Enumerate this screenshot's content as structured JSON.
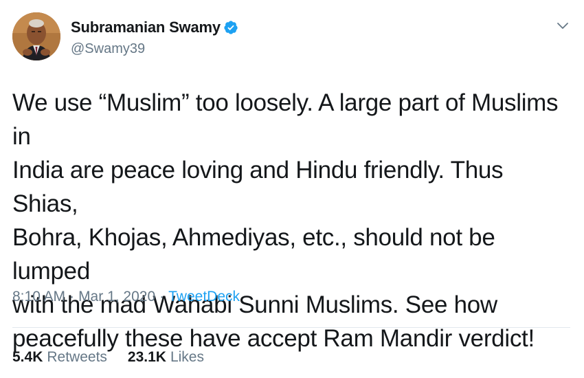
{
  "tweet": {
    "author": {
      "display_name": "Subramanian Swamy",
      "handle": "@Swamy39",
      "verified": true,
      "avatar_icon": "profile-photo"
    },
    "menu_icon": "chevron-down-icon",
    "text": "We use “Muslim” too loosely. A large part of Muslims in\nIndia are peace loving and Hindu friendly. Thus Shias,\nBohra, Khojas, Ahmediyas, etc., should not be lumped\nwith the mad Wahabi Sunni Muslims. See how\npeacefully these have accept Ram Mandir verdict!",
    "meta": {
      "time": "8:10 AM",
      "separator": "·",
      "date": "Mar 1, 2020",
      "source": "TweetDeck"
    },
    "stats": {
      "retweets_count": "5.4K",
      "retweets_label": "Retweets",
      "likes_count": "23.1K",
      "likes_label": "Likes"
    }
  },
  "colors": {
    "text_primary": "#14171a",
    "text_secondary": "#657786",
    "accent": "#1da1f2",
    "divider": "#e1e8ed"
  }
}
